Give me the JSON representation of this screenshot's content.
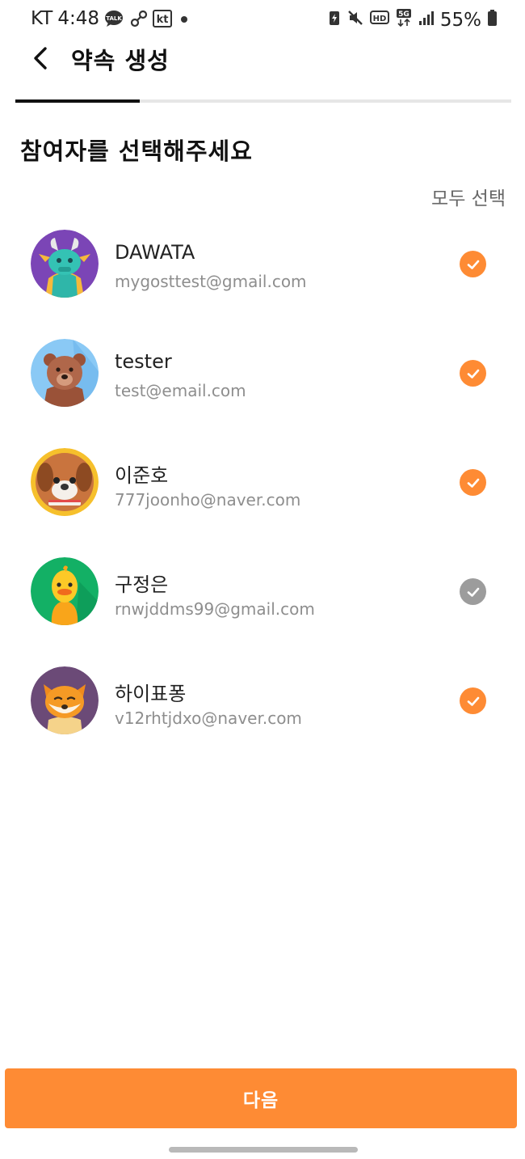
{
  "status_bar": {
    "carrier": "KT",
    "time": "4:48",
    "talk_badge": "TALK",
    "kt_badge": "kt",
    "battery": "55%",
    "network": "5G",
    "hd": "HD"
  },
  "header": {
    "title": "약속 생성",
    "progress": 0.25
  },
  "section": {
    "title": "참여자를 선택해주세요",
    "select_all": "모두 선택"
  },
  "participants": [
    {
      "name": "DAWATA",
      "email": "mygosttest@gmail.com",
      "selected": true,
      "avatar": "dragon"
    },
    {
      "name": "tester",
      "email": "test@email.com",
      "selected": true,
      "avatar": "bear"
    },
    {
      "name": "이준호",
      "email": "777joonho@naver.com",
      "selected": true,
      "avatar": "dog"
    },
    {
      "name": "구정은",
      "email": "rnwjddms99@gmail.com",
      "selected": false,
      "avatar": "duck"
    },
    {
      "name": "하이표퐁",
      "email": "v12rhtjdxo@naver.com",
      "selected": true,
      "avatar": "fox"
    }
  ],
  "colors": {
    "accent": "#fe8b34",
    "unselected": "#9c9c9c"
  },
  "footer": {
    "next_label": "다음"
  }
}
